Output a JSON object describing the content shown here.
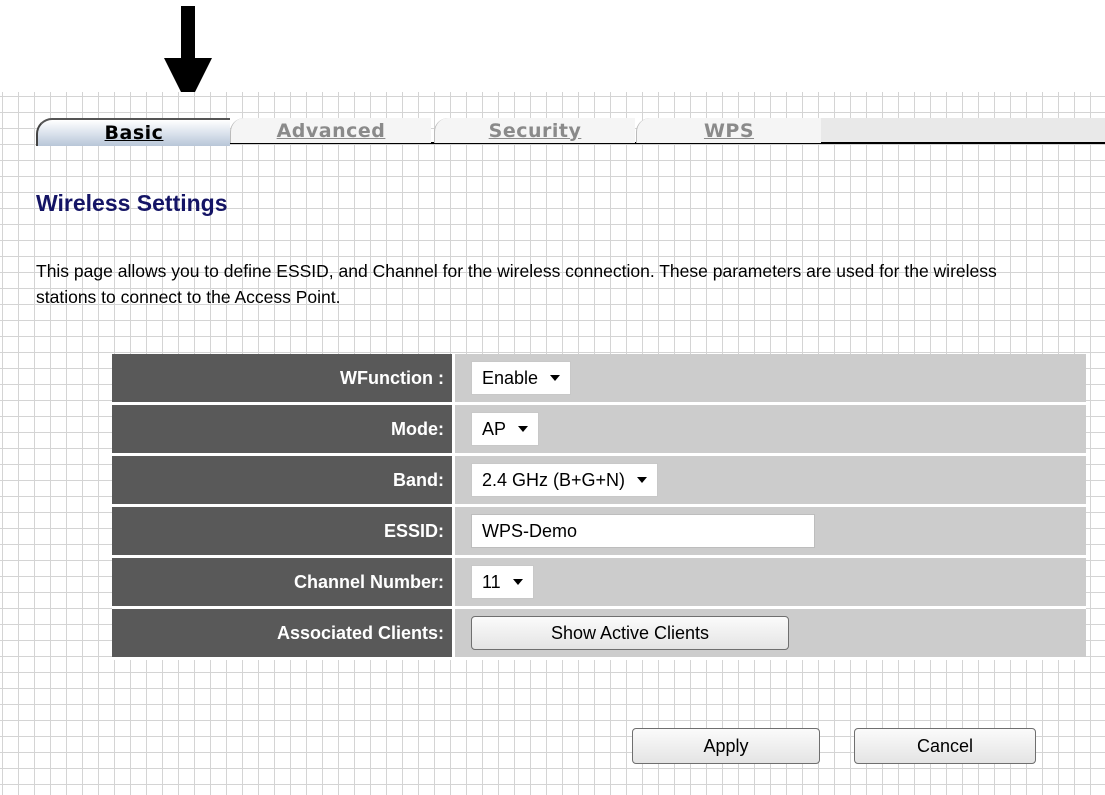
{
  "tabs": [
    {
      "label": "Basic",
      "active": true
    },
    {
      "label": "Advanced",
      "active": false
    },
    {
      "label": "Security",
      "active": false
    },
    {
      "label": "WPS",
      "active": false
    }
  ],
  "page": {
    "title": "Wireless Settings",
    "description": "This page allows you to define ESSID, and Channel for the wireless connection. These parameters are used for the wireless stations to connect to the Access Point."
  },
  "form": {
    "wfunction": {
      "label": "WFunction :",
      "value": "Enable"
    },
    "mode": {
      "label": "Mode:",
      "value": "AP"
    },
    "band": {
      "label": "Band:",
      "value": "2.4 GHz (B+G+N)"
    },
    "essid": {
      "label": "ESSID:",
      "value": "WPS-Demo"
    },
    "channel": {
      "label": "Channel Number:",
      "value": "11"
    },
    "clients": {
      "label": "Associated Clients:",
      "button": "Show Active Clients"
    }
  },
  "actions": {
    "apply": "Apply",
    "cancel": "Cancel"
  },
  "colors": {
    "title": "#141465",
    "label_bg": "#595959",
    "value_bg": "#cccccc",
    "annotation_arrow": "#000000"
  },
  "icons": {
    "annotation": "down-arrow-icon",
    "dropdown": "chevron-down-icon"
  }
}
